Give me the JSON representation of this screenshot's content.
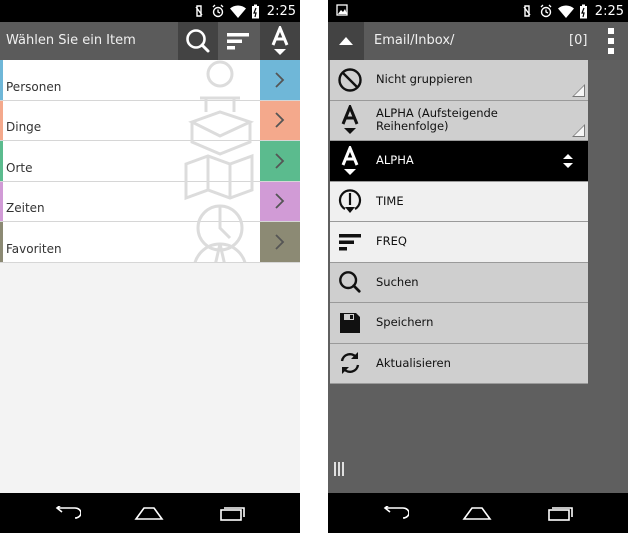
{
  "left_screen": {
    "status": {
      "time": "2:25"
    },
    "actionbar": {
      "title": "Wählen Sie ein Item"
    },
    "list": [
      {
        "label": "Personen",
        "color": "#6fb7d8"
      },
      {
        "label": "Dinge",
        "color": "#f4a98c"
      },
      {
        "label": "Orte",
        "color": "#5bbb8e"
      },
      {
        "label": "Zeiten",
        "color": "#d19bd6"
      },
      {
        "label": "Favoriten",
        "color": "#8c8a74"
      }
    ]
  },
  "right_screen": {
    "status": {
      "time": "2:25"
    },
    "actionbar": {
      "path": "Email/Inbox/",
      "count": "[0]"
    },
    "menu": [
      {
        "label": "Nicht gruppieren",
        "icon": "no-group-icon"
      },
      {
        "label": "ALPHA (Aufsteigende Reihenfolge)",
        "icon": "alpha-sort-icon"
      },
      {
        "label": "ALPHA",
        "icon": "alpha-sort-icon",
        "selected": true
      },
      {
        "label": "TIME",
        "icon": "clock-icon"
      },
      {
        "label": "FREQ",
        "icon": "freq-icon"
      },
      {
        "label": "Suchen",
        "icon": "search-icon"
      },
      {
        "label": "Speichern",
        "icon": "save-icon"
      },
      {
        "label": "Aktualisieren",
        "icon": "refresh-icon"
      }
    ]
  }
}
